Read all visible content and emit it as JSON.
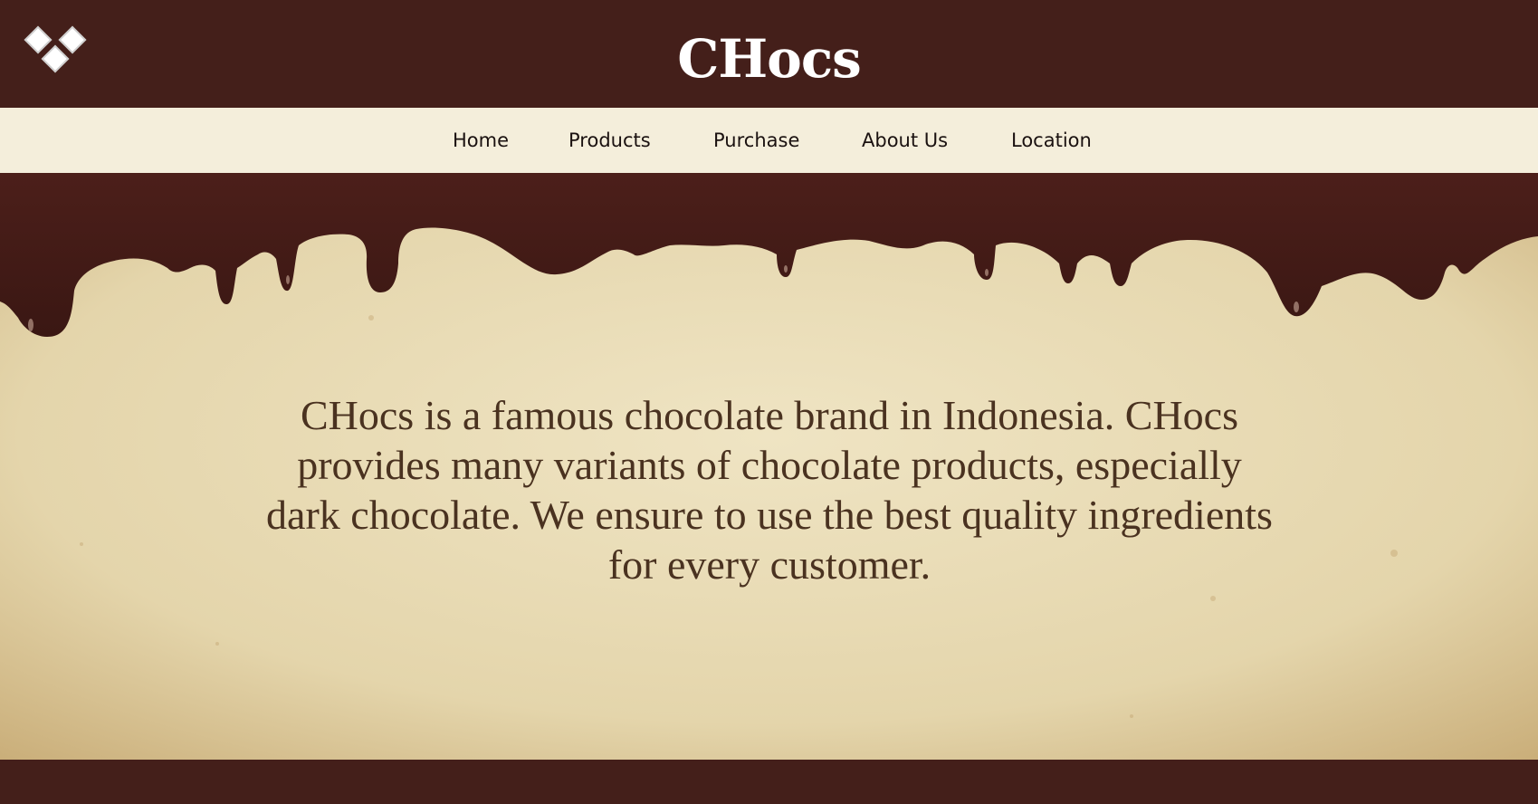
{
  "header": {
    "brand": "CHocs",
    "logo_icon": "diamond-cluster-icon"
  },
  "nav": {
    "items": [
      {
        "label": "Home"
      },
      {
        "label": "Products"
      },
      {
        "label": "Purchase"
      },
      {
        "label": "About Us"
      },
      {
        "label": "Location"
      }
    ]
  },
  "hero": {
    "text": "CHocs is a famous chocolate brand in Indonesia. CHocs provides many variants of chocolate products, especially dark chocolate. We ensure to use the best quality ingredients for every customer."
  },
  "colors": {
    "chocolate": "#441f1a",
    "nav_bg": "#f4eedb",
    "paper": "#e9dcb6",
    "hero_text": "#4a3220"
  }
}
